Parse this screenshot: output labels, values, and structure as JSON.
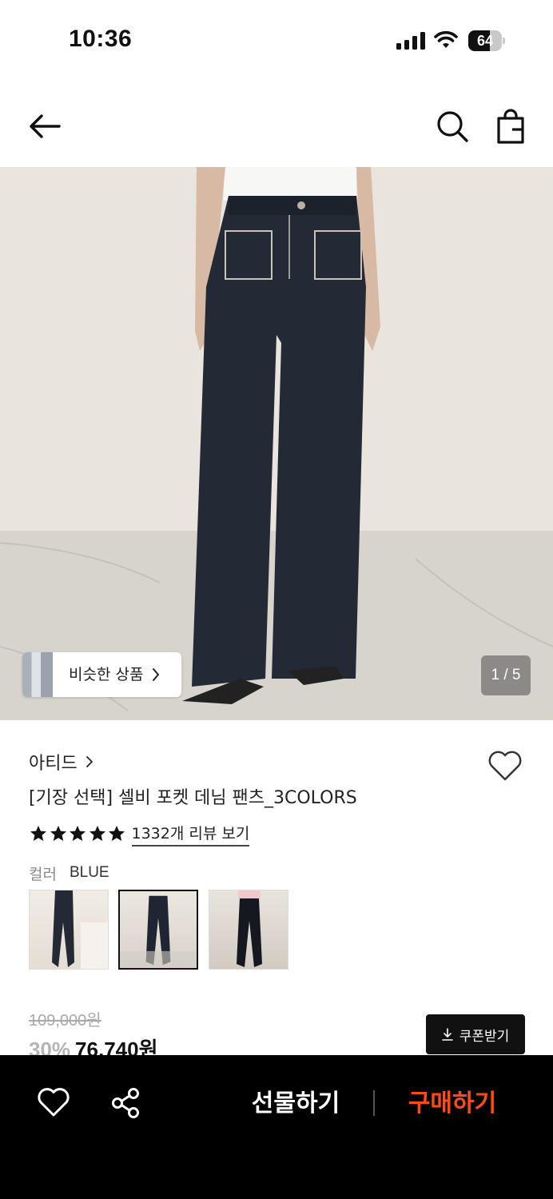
{
  "status_bar": {
    "time": "10:36",
    "battery_level": "64",
    "battery_fraction": 0.64
  },
  "nav": {
    "back_icon": "arrow-left-icon",
    "search_icon": "search-icon",
    "bag_icon": "shopping-bag-icon"
  },
  "hero": {
    "similar_label": "비슷한 상품",
    "page_indicator": "1 / 5",
    "current_page": 1,
    "total_pages": 5
  },
  "product": {
    "brand": "아티드",
    "title": "[기장 선택] 셀비 포켓 데님 팬츠_3COLORS",
    "rating_stars": 5,
    "review_link": "1332개 리뷰 보기",
    "color_label": "컬러",
    "color_value": "BLUE",
    "selected_swatch": 2,
    "original_price": "109,000원",
    "discount": "30%",
    "sale_price": "76,740원",
    "coupon_label": "쿠폰받기"
  },
  "bottom_bar": {
    "gift_label": "선물하기",
    "buy_label": "구매하기",
    "buy_color": "#ff4a17"
  }
}
